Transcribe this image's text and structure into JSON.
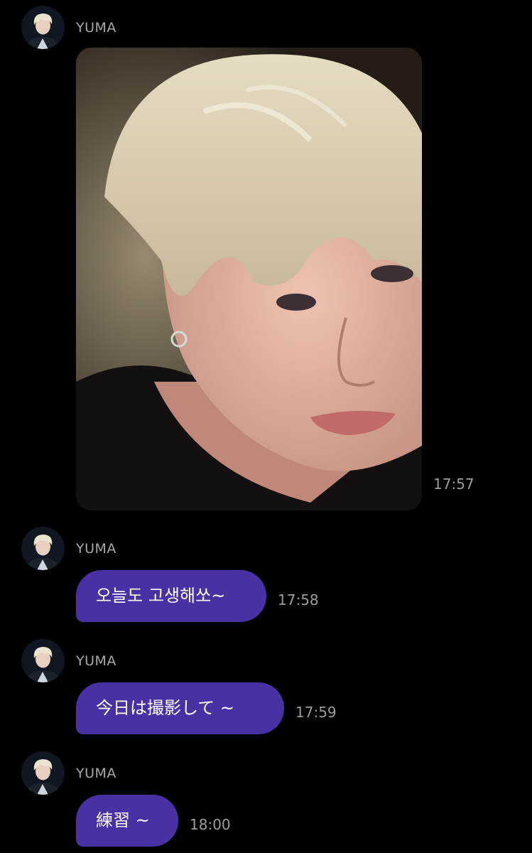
{
  "messages": [
    {
      "sender": "YUMA",
      "type": "image",
      "image_desc": "selfie photo",
      "time": "17:57"
    },
    {
      "sender": "YUMA",
      "type": "text",
      "text": "오늘도 고생해쏘~",
      "time": "17:58"
    },
    {
      "sender": "YUMA",
      "type": "text",
      "text": "今日は撮影して ~",
      "time": "17:59"
    },
    {
      "sender": "YUMA",
      "type": "text",
      "text": "練習 ~",
      "time": "18:00"
    }
  ],
  "colors": {
    "background": "#000000",
    "bubble": "#4a31a3",
    "sender_name": "#a8a8ad",
    "timestamp": "#9c9ca1"
  },
  "icons": {
    "avatar": "profile-avatar"
  }
}
